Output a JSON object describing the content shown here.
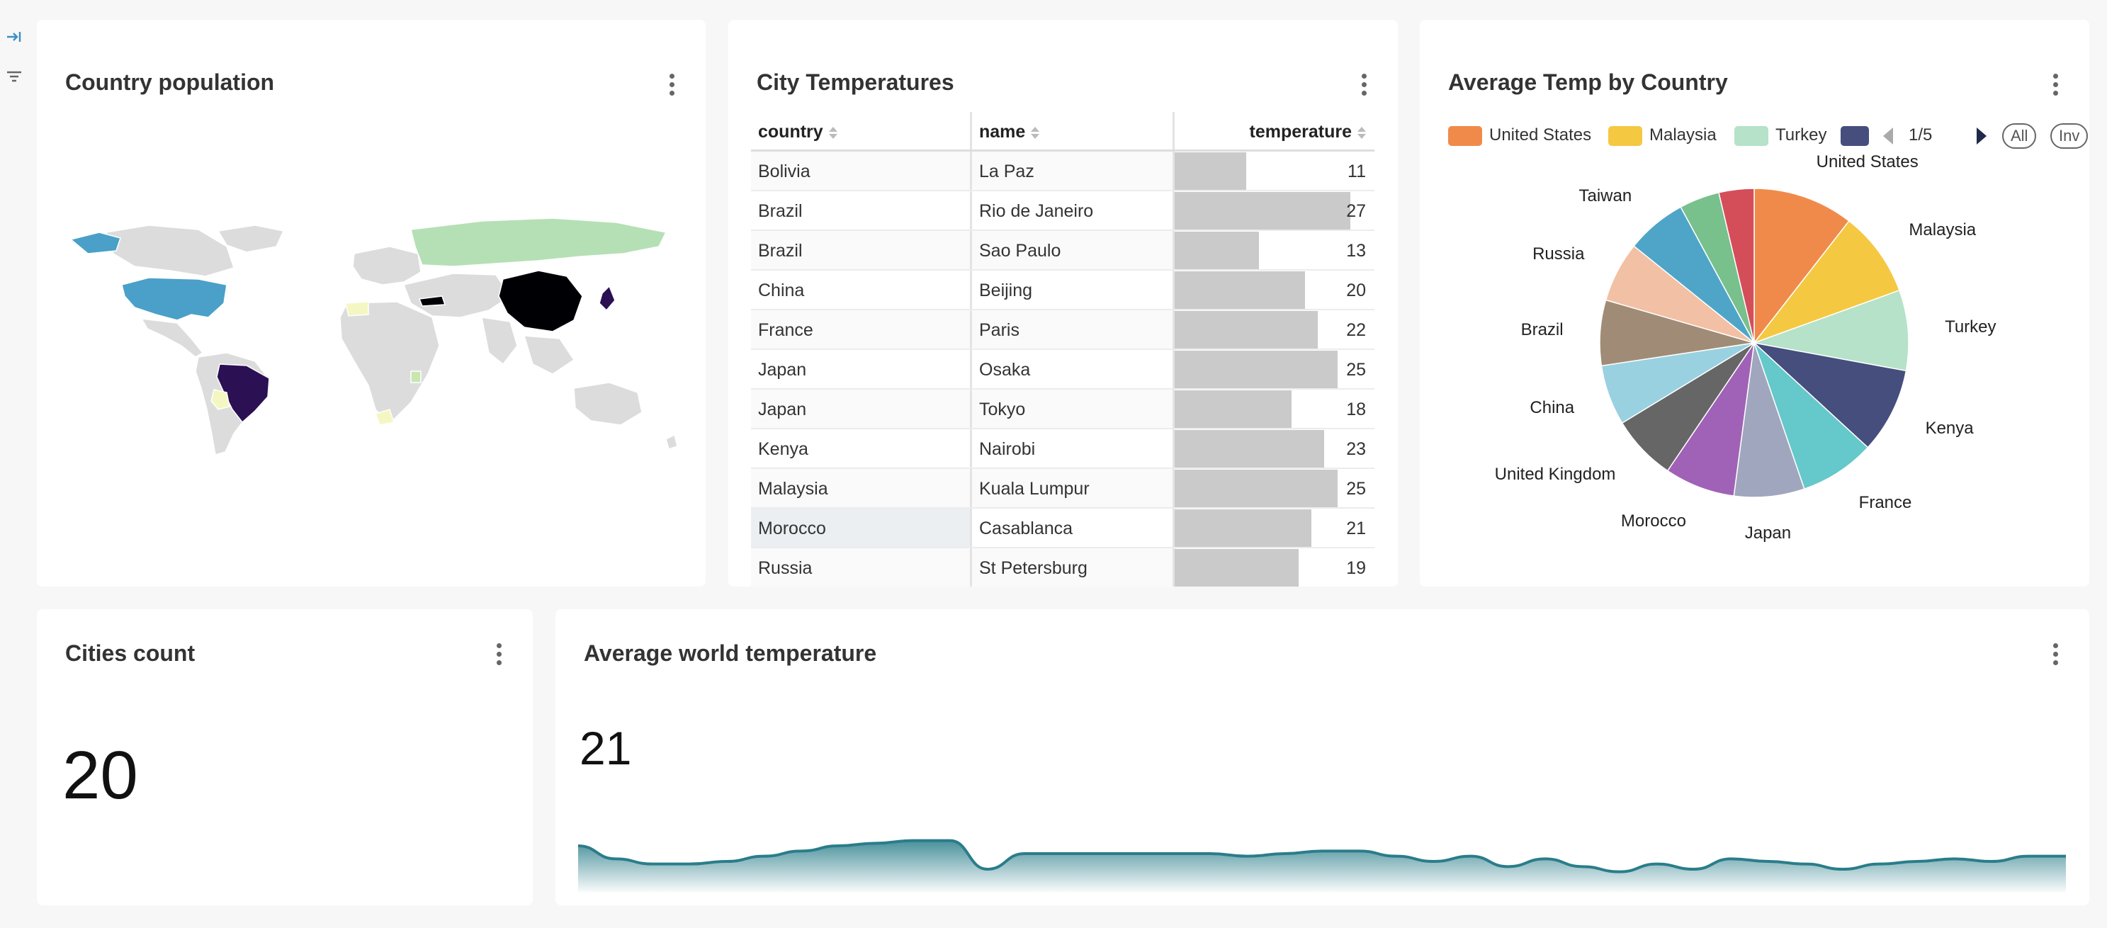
{
  "cards": {
    "population": {
      "title": "Country population"
    },
    "cities": {
      "title": "City Temperatures"
    },
    "avg_temp": {
      "title": "Average Temp by Country"
    },
    "count": {
      "title": "Cities count",
      "value": "20"
    },
    "world": {
      "title": "Average world temperature",
      "value": "21"
    }
  },
  "map_colors": {
    "ocean": "#ffffff",
    "land": "#d9d9d9",
    "usa": "#4aa0c8",
    "brazil": "#2b1054",
    "china": "#000004",
    "russia": "#b5e0b5"
  },
  "table": {
    "headers": {
      "country": "country",
      "name": "name",
      "temperature": "temperature"
    },
    "max": 27,
    "rows": [
      {
        "country": "Bolivia",
        "name": "La Paz",
        "temperature": 11
      },
      {
        "country": "Brazil",
        "name": "Rio de Janeiro",
        "temperature": 27
      },
      {
        "country": "Brazil",
        "name": "Sao Paulo",
        "temperature": 13
      },
      {
        "country": "China",
        "name": "Beijing",
        "temperature": 20
      },
      {
        "country": "France",
        "name": "Paris",
        "temperature": 22
      },
      {
        "country": "Japan",
        "name": "Osaka",
        "temperature": 25
      },
      {
        "country": "Japan",
        "name": "Tokyo",
        "temperature": 18
      },
      {
        "country": "Kenya",
        "name": "Nairobi",
        "temperature": 23
      },
      {
        "country": "Malaysia",
        "name": "Kuala Lumpur",
        "temperature": 25
      },
      {
        "country": "Morocco",
        "name": "Casablanca",
        "temperature": 21
      },
      {
        "country": "Russia",
        "name": "St Petersburg",
        "temperature": 19
      }
    ]
  },
  "legend": {
    "items": [
      {
        "name": "United States",
        "color": "#f08a4b"
      },
      {
        "name": "Malaysia",
        "color": "#f5c842"
      },
      {
        "name": "Turkey",
        "color": "#b5e2c8"
      },
      {
        "name": "",
        "color": "#454e7c"
      }
    ],
    "page": "1/5",
    "all_label": "All",
    "inv_label": "Inv"
  },
  "chart_data": [
    {
      "type": "pie",
      "title": "Average Temp by Country",
      "categories": [
        "United States",
        "Malaysia",
        "Turkey",
        "Kenya",
        "France",
        "Japan",
        "Morocco",
        "United Kingdom",
        "China",
        "Brazil",
        "Russia",
        "Taiwan",
        "",
        ""
      ],
      "values": [
        20,
        17,
        16,
        17,
        15,
        14,
        14,
        13,
        12,
        13,
        12,
        12,
        8,
        7
      ],
      "colors": [
        "#f08a4b",
        "#f5c842",
        "#b5e2c8",
        "#454e7c",
        "#65c8ca",
        "#a0a6bd",
        "#a062b6",
        "#666666",
        "#99d1e0",
        "#a08c76",
        "#f2c0a4",
        "#4fa5c8",
        "#78c08c",
        "#d44e5a"
      ],
      "legend": "top"
    },
    {
      "type": "area",
      "title": "Average world temperature",
      "x": [
        0,
        1,
        2,
        3,
        4,
        5,
        6,
        7,
        8,
        9,
        10,
        11,
        12,
        13,
        14,
        15,
        16,
        17,
        18,
        19,
        20,
        21,
        22,
        23,
        24,
        25,
        26,
        27,
        28,
        29,
        30,
        31,
        32,
        33,
        34,
        35,
        36,
        37,
        38,
        39,
        40
      ],
      "values": [
        20.8,
        20.3,
        20.1,
        20.1,
        20.2,
        20.4,
        20.6,
        20.8,
        20.9,
        21.0,
        21.0,
        19.9,
        20.5,
        20.5,
        20.5,
        20.5,
        20.5,
        20.5,
        20.4,
        20.5,
        20.6,
        20.6,
        20.4,
        20.2,
        20.4,
        20.0,
        20.3,
        20.0,
        19.8,
        20.1,
        19.9,
        20.3,
        20.2,
        20.1,
        19.9,
        20.1,
        20.2,
        20.3,
        20.2,
        20.4,
        20.4
      ],
      "color": "#2a7d8a"
    }
  ]
}
